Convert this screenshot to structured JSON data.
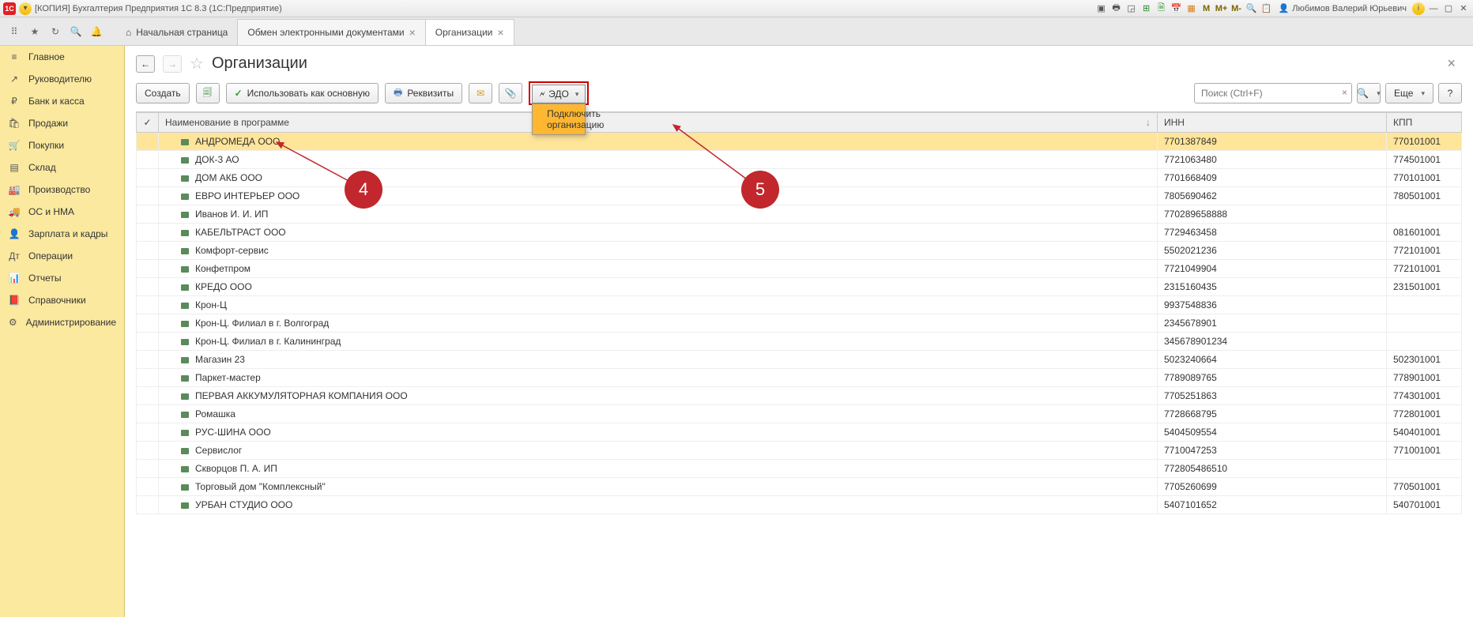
{
  "titlebar": {
    "app_title": "[КОПИЯ] Бухгалтерия Предприятия 1С 8.3  (1С:Предприятие)",
    "user": "Любимов Валерий Юрьевич",
    "marks": {
      "m": "M",
      "m_plus": "M+",
      "m_minus": "M-"
    }
  },
  "tabs": {
    "home": "Начальная страница",
    "t1": "Обмен электронными документами",
    "t2": "Организации"
  },
  "sidebar": {
    "items": [
      {
        "icon": "≡",
        "label": "Главное"
      },
      {
        "icon": "↗",
        "label": "Руководителю"
      },
      {
        "icon": "₽",
        "label": "Банк и касса"
      },
      {
        "icon": "🛍",
        "label": "Продажи"
      },
      {
        "icon": "🛒",
        "label": "Покупки"
      },
      {
        "icon": "▤",
        "label": "Склад"
      },
      {
        "icon": "🏭",
        "label": "Производство"
      },
      {
        "icon": "🚚",
        "label": "ОС и НМА"
      },
      {
        "icon": "👤",
        "label": "Зарплата и кадры"
      },
      {
        "icon": "Дт",
        "label": "Операции"
      },
      {
        "icon": "📊",
        "label": "Отчеты"
      },
      {
        "icon": "📕",
        "label": "Справочники"
      },
      {
        "icon": "⚙",
        "label": "Администрирование"
      }
    ]
  },
  "page": {
    "title": "Организации"
  },
  "toolbar": {
    "create": "Создать",
    "use_as_main": "Использовать как основную",
    "details": "Реквизиты",
    "edo": "ЭДО",
    "edo_menu": "Подключить организацию",
    "search_placeholder": "Поиск (Ctrl+F)",
    "more": "Еще"
  },
  "columns": {
    "check": "✓",
    "name": "Наименование в программе",
    "inn": "ИНН",
    "kpp": "КПП"
  },
  "rows": [
    {
      "name": "АНДРОМЕДА ООО",
      "inn": "7701387849",
      "kpp": "770101001",
      "sel": true
    },
    {
      "name": "ДОК-3 АО",
      "inn": "7721063480",
      "kpp": "774501001"
    },
    {
      "name": "ДОМ АКБ ООО",
      "inn": "7701668409",
      "kpp": "770101001"
    },
    {
      "name": "ЕВРО ИНТЕРЬЕР ООО",
      "inn": "7805690462",
      "kpp": "780501001"
    },
    {
      "name": "Иванов И. И. ИП",
      "inn": "770289658888",
      "kpp": ""
    },
    {
      "name": "КАБЕЛЬТРАСТ ООО",
      "inn": "7729463458",
      "kpp": "081601001"
    },
    {
      "name": "Комфорт-сервис",
      "inn": "5502021236",
      "kpp": "772101001"
    },
    {
      "name": "Конфетпром",
      "inn": "7721049904",
      "kpp": "772101001"
    },
    {
      "name": "КРЕДО ООО",
      "inn": "2315160435",
      "kpp": "231501001"
    },
    {
      "name": "Крон-Ц",
      "inn": "9937548836",
      "kpp": ""
    },
    {
      "name": "Крон-Ц. Филиал в г. Волгоград",
      "inn": "2345678901",
      "kpp": ""
    },
    {
      "name": "Крон-Ц. Филиал в г. Калининград",
      "inn": "345678901234",
      "kpp": ""
    },
    {
      "name": "Магазин 23",
      "inn": "5023240664",
      "kpp": "502301001"
    },
    {
      "name": "Паркет-мастер",
      "inn": "7789089765",
      "kpp": "778901001"
    },
    {
      "name": "ПЕРВАЯ АККУМУЛЯТОРНАЯ КОМПАНИЯ ООО",
      "inn": "7705251863",
      "kpp": "774301001"
    },
    {
      "name": "Ромашка",
      "inn": "7728668795",
      "kpp": "772801001"
    },
    {
      "name": "РУС-ШИНА ООО",
      "inn": "5404509554",
      "kpp": "540401001"
    },
    {
      "name": "Сервислог",
      "inn": "7710047253",
      "kpp": "771001001"
    },
    {
      "name": "Скворцов П. А. ИП",
      "inn": "772805486510",
      "kpp": ""
    },
    {
      "name": "Торговый дом \"Комплексный\"",
      "inn": "7705260699",
      "kpp": "770501001"
    },
    {
      "name": "УРБАН СТУДИО ООО",
      "inn": "5407101652",
      "kpp": "540701001"
    }
  ],
  "anno": {
    "a4": "4",
    "a5": "5"
  }
}
